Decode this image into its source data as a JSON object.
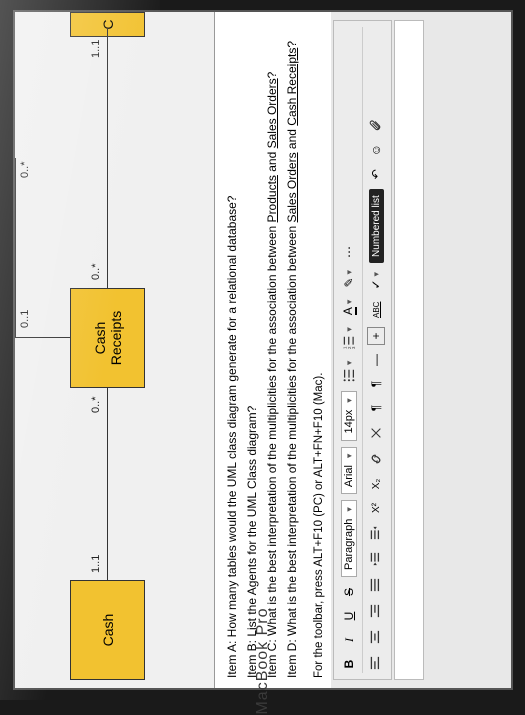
{
  "uml": {
    "boxes": {
      "cash": "Cash",
      "receipts": "Cash\nReceipts",
      "right_partial": "C"
    },
    "multiplicities": {
      "cash_right": "1..1",
      "receipts_left": "0..*",
      "receipts_right": "0..*",
      "far_right_left": "1..1",
      "top_left": "0..1",
      "top_right": "0..*"
    }
  },
  "questions": {
    "a": "Item A: How many tables would the UML class diagram generate for a relational database?",
    "b": "Item B: List the Agents for the UML Class diagram?",
    "c_pre": "Item C: What is the best interpretation of the multiplicities for the association between ",
    "c_u1": "Products",
    "c_mid": " and ",
    "c_u2": "Sales Orders",
    "c_post": "?",
    "d_pre": "Item D: What is the best interpretation of the multiplicities for the association between ",
    "d_u1": "Sales Orders",
    "d_mid": " and ",
    "d_u2": "Cash Receipts",
    "d_post": "?"
  },
  "toolbar_hint": "For the toolbar, press ALT+F10 (PC) or ALT+FN+F10 (Mac).",
  "toolbar": {
    "bold": "B",
    "italic": "I",
    "underline": "U",
    "strike": "S",
    "paragraph": "Paragraph",
    "font": "Arial",
    "size": "14px",
    "superscript": "X²",
    "subscript": "X₂",
    "pilcrow_rtl": "¶",
    "pilcrow_ltr": "¶",
    "dash": "—",
    "plus": "+",
    "abc": "ABC",
    "check": "✓",
    "tooltip_numbered": "Numbered list",
    "letter_a": "A",
    "pencil": "✎"
  },
  "device": "MacBook Pro"
}
